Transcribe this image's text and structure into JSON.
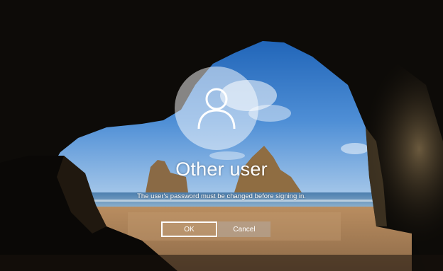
{
  "user": {
    "name": "Other user",
    "icon": "user-icon"
  },
  "message": "The user's password must be changed before signing in.",
  "buttons": {
    "ok_label": "OK",
    "cancel_label": "Cancel"
  },
  "background": {
    "icon": "cave-beach-wallpaper"
  },
  "colors": {
    "text": "#ffffff",
    "avatar_bg": "#9a9a9a",
    "cancel_bg": "#8a827a"
  }
}
